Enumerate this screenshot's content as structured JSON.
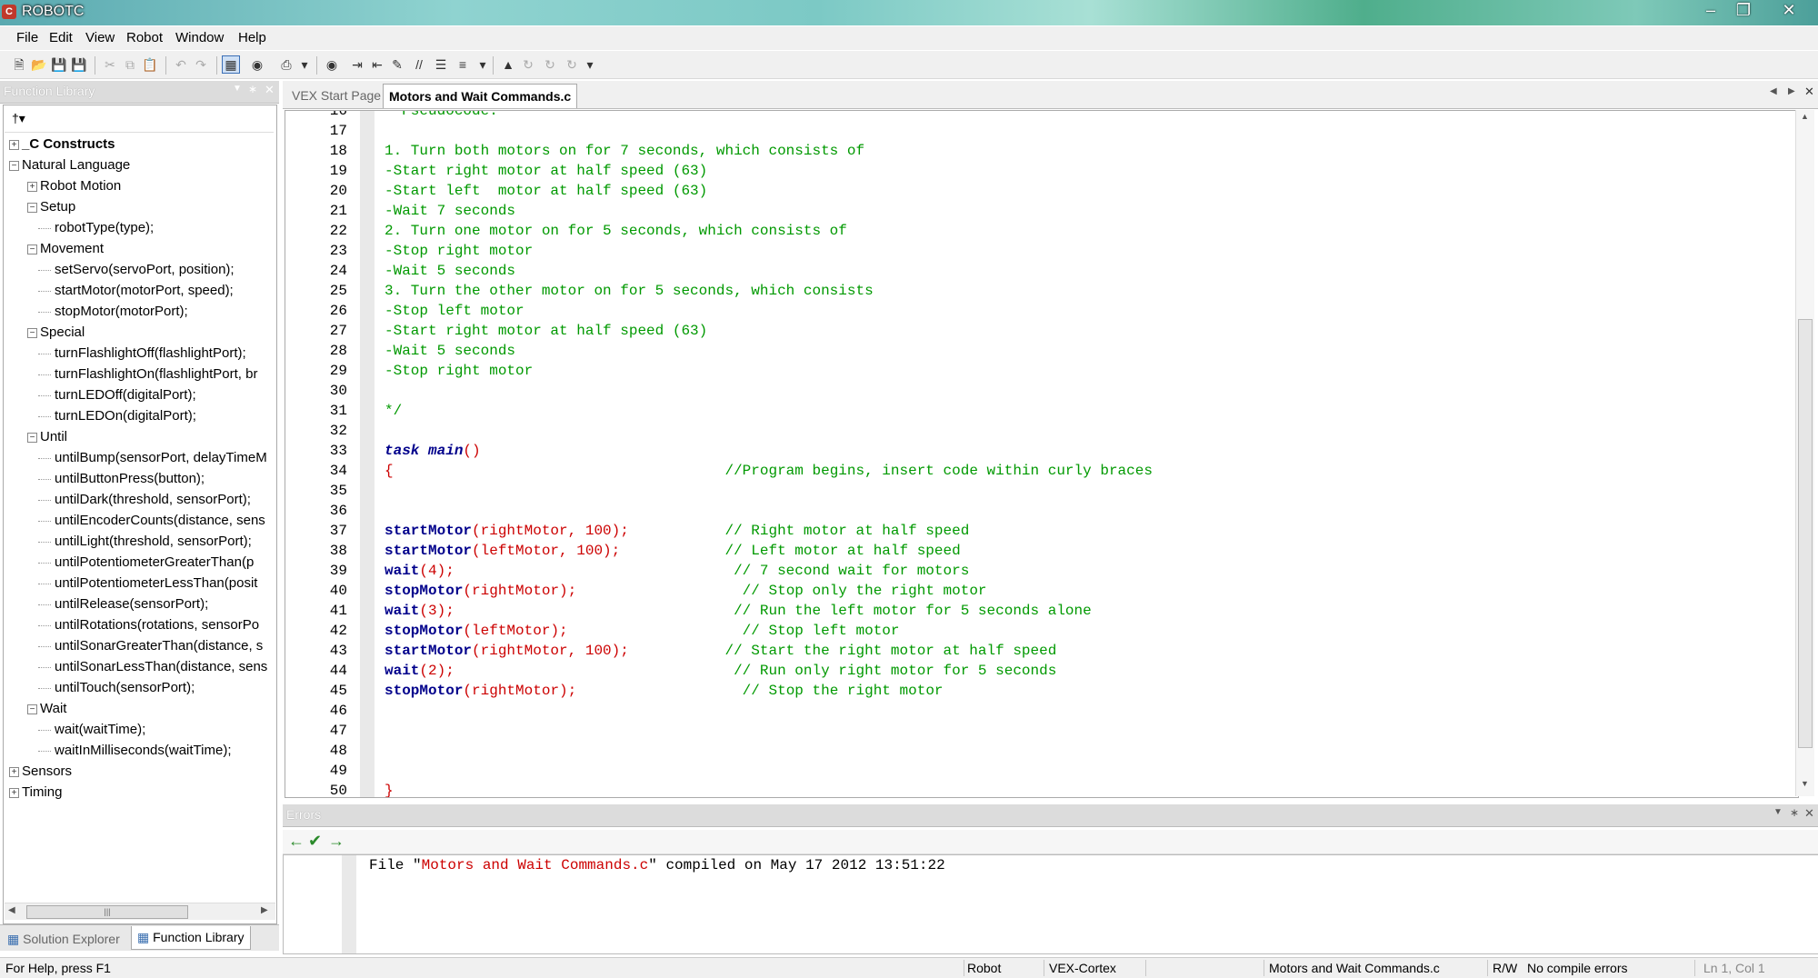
{
  "window": {
    "title": "ROBOTC",
    "controls": [
      "minimize-icon",
      "maximize-icon",
      "close-icon"
    ]
  },
  "menu": [
    "File",
    "Edit",
    "View",
    "Robot",
    "Window",
    "Help"
  ],
  "function_library": {
    "title": "Function Library",
    "tree": [
      {
        "label": "_C Constructs",
        "depth": 0,
        "expander": "+",
        "bold": true
      },
      {
        "label": "Natural Language",
        "depth": 0,
        "expander": "-"
      },
      {
        "label": "Robot Motion",
        "depth": 1,
        "expander": "+"
      },
      {
        "label": "Setup",
        "depth": 1,
        "expander": "-"
      },
      {
        "label": "robotType(type);",
        "depth": 2
      },
      {
        "label": "Movement",
        "depth": 1,
        "expander": "-"
      },
      {
        "label": "setServo(servoPort, position);",
        "depth": 2
      },
      {
        "label": "startMotor(motorPort, speed);",
        "depth": 2
      },
      {
        "label": "stopMotor(motorPort);",
        "depth": 2
      },
      {
        "label": "Special",
        "depth": 1,
        "expander": "-"
      },
      {
        "label": "turnFlashlightOff(flashlightPort);",
        "depth": 2
      },
      {
        "label": "turnFlashlightOn(flashlightPort, br",
        "depth": 2
      },
      {
        "label": "turnLEDOff(digitalPort);",
        "depth": 2
      },
      {
        "label": "turnLEDOn(digitalPort);",
        "depth": 2
      },
      {
        "label": "Until",
        "depth": 1,
        "expander": "-"
      },
      {
        "label": "untilBump(sensorPort, delayTimeM",
        "depth": 2
      },
      {
        "label": "untilButtonPress(button);",
        "depth": 2
      },
      {
        "label": "untilDark(threshold, sensorPort);",
        "depth": 2
      },
      {
        "label": "untilEncoderCounts(distance, sens",
        "depth": 2
      },
      {
        "label": "untilLight(threshold, sensorPort);",
        "depth": 2
      },
      {
        "label": "untilPotentiometerGreaterThan(p",
        "depth": 2
      },
      {
        "label": "untilPotentiometerLessThan(posit",
        "depth": 2
      },
      {
        "label": "untilRelease(sensorPort);",
        "depth": 2
      },
      {
        "label": "untilRotations(rotations, sensorPo",
        "depth": 2
      },
      {
        "label": "untilSonarGreaterThan(distance, s",
        "depth": 2
      },
      {
        "label": "untilSonarLessThan(distance, sens",
        "depth": 2
      },
      {
        "label": "untilTouch(sensorPort);",
        "depth": 2
      },
      {
        "label": "Wait",
        "depth": 1,
        "expander": "-"
      },
      {
        "label": "wait(waitTime);",
        "depth": 2
      },
      {
        "label": "waitInMilliseconds(waitTime);",
        "depth": 2
      },
      {
        "label": "Sensors",
        "depth": 0,
        "expander": "+"
      },
      {
        "label": "Timing",
        "depth": 0,
        "expander": "+"
      }
    ]
  },
  "bottom_tabs": [
    "Solution Explorer",
    "Function Library"
  ],
  "editor_tabs": [
    "VEX Start Page",
    "Motors and Wait Commands.c"
  ],
  "code_lines": [
    {
      "n": "16",
      "parts": [
        [
          "c-green",
          "  Pseudocode:"
        ]
      ]
    },
    {
      "n": "17",
      "parts": []
    },
    {
      "n": "18",
      "parts": [
        [
          "c-green",
          "1. Turn both motors on for 7 seconds, which consists of"
        ]
      ]
    },
    {
      "n": "19",
      "parts": [
        [
          "c-green",
          "-Start right motor at half speed (63)"
        ]
      ]
    },
    {
      "n": "20",
      "parts": [
        [
          "c-green",
          "-Start left  motor at half speed (63)"
        ]
      ]
    },
    {
      "n": "21",
      "parts": [
        [
          "c-green",
          "-Wait 7 seconds"
        ]
      ]
    },
    {
      "n": "22",
      "parts": [
        [
          "c-green",
          "2. Turn one motor on for 5 seconds, which consists of"
        ]
      ]
    },
    {
      "n": "23",
      "parts": [
        [
          "c-green",
          "-Stop right motor"
        ]
      ]
    },
    {
      "n": "24",
      "parts": [
        [
          "c-green",
          "-Wait 5 seconds"
        ]
      ]
    },
    {
      "n": "25",
      "parts": [
        [
          "c-green",
          "3. Turn the other motor on for 5 seconds, which consists"
        ]
      ]
    },
    {
      "n": "26",
      "parts": [
        [
          "c-green",
          "-Stop left motor"
        ]
      ]
    },
    {
      "n": "27",
      "parts": [
        [
          "c-green",
          "-Start right motor at half speed (63)"
        ]
      ]
    },
    {
      "n": "28",
      "parts": [
        [
          "c-green",
          "-Wait 5 seconds"
        ]
      ]
    },
    {
      "n": "29",
      "parts": [
        [
          "c-green",
          "-Stop right motor"
        ]
      ]
    },
    {
      "n": "30",
      "parts": []
    },
    {
      "n": "31",
      "parts": [
        [
          "c-green",
          "*/"
        ]
      ]
    },
    {
      "n": "32",
      "parts": []
    },
    {
      "n": "33",
      "parts": [
        [
          "c-kwi",
          "task main"
        ],
        [
          "c-red",
          "()"
        ]
      ]
    },
    {
      "n": "34",
      "parts": [
        [
          "c-red",
          "{"
        ],
        [
          "c-cm",
          "                                      //Program begins, insert code within curly braces"
        ]
      ]
    },
    {
      "n": "35",
      "parts": []
    },
    {
      "n": "36",
      "parts": []
    },
    {
      "n": "37",
      "parts": [
        [
          "c-kw",
          "startMotor"
        ],
        [
          "c-red",
          "(rightMotor, 100);"
        ],
        [
          "c-cm",
          "           // Right motor at half speed"
        ]
      ]
    },
    {
      "n": "38",
      "parts": [
        [
          "c-kw",
          "startMotor"
        ],
        [
          "c-red",
          "(leftMotor, 100);"
        ],
        [
          "c-cm",
          "            // Left motor at half speed"
        ]
      ]
    },
    {
      "n": "39",
      "parts": [
        [
          "c-kw",
          "wait"
        ],
        [
          "c-red",
          "(4);"
        ],
        [
          "c-cm",
          "                                // 7 second wait for motors"
        ]
      ]
    },
    {
      "n": "40",
      "parts": [
        [
          "c-kw",
          "stopMotor"
        ],
        [
          "c-red",
          "(rightMotor);"
        ],
        [
          "c-cm",
          "                   // Stop only the right motor"
        ]
      ]
    },
    {
      "n": "41",
      "parts": [
        [
          "c-kw",
          "wait"
        ],
        [
          "c-red",
          "(3);"
        ],
        [
          "c-cm",
          "                                // Run the left motor for 5 seconds alone"
        ]
      ]
    },
    {
      "n": "42",
      "parts": [
        [
          "c-kw",
          "stopMotor"
        ],
        [
          "c-red",
          "(leftMotor);"
        ],
        [
          "c-cm",
          "                    // Stop left motor"
        ]
      ]
    },
    {
      "n": "43",
      "parts": [
        [
          "c-kw",
          "startMotor"
        ],
        [
          "c-red",
          "(rightMotor, 100);"
        ],
        [
          "c-cm",
          "           // Start the right motor at half speed"
        ]
      ]
    },
    {
      "n": "44",
      "parts": [
        [
          "c-kw",
          "wait"
        ],
        [
          "c-red",
          "(2);"
        ],
        [
          "c-cm",
          "                                // Run only right motor for 5 seconds"
        ]
      ]
    },
    {
      "n": "45",
      "parts": [
        [
          "c-kw",
          "stopMotor"
        ],
        [
          "c-red",
          "(rightMotor);"
        ],
        [
          "c-cm",
          "                   // Stop the right motor"
        ]
      ]
    },
    {
      "n": "46",
      "parts": []
    },
    {
      "n": "47",
      "parts": []
    },
    {
      "n": "48",
      "parts": []
    },
    {
      "n": "49",
      "parts": []
    },
    {
      "n": "50",
      "parts": [
        [
          "c-red",
          "}"
        ]
      ]
    }
  ],
  "errors": {
    "title": "Errors",
    "message_prefix": "File \"",
    "file": "Motors and Wait Commands.c",
    "message_suffix": "\" compiled on May 17 2012 13:51:22"
  },
  "status": {
    "help": "For Help, press F1",
    "robot": "Robot",
    "platform": "VEX-Cortex",
    "file": "Motors and Wait Commands.c",
    "mode": "R/W",
    "compile": "No compile errors",
    "position": "Ln 1, Col 1"
  }
}
